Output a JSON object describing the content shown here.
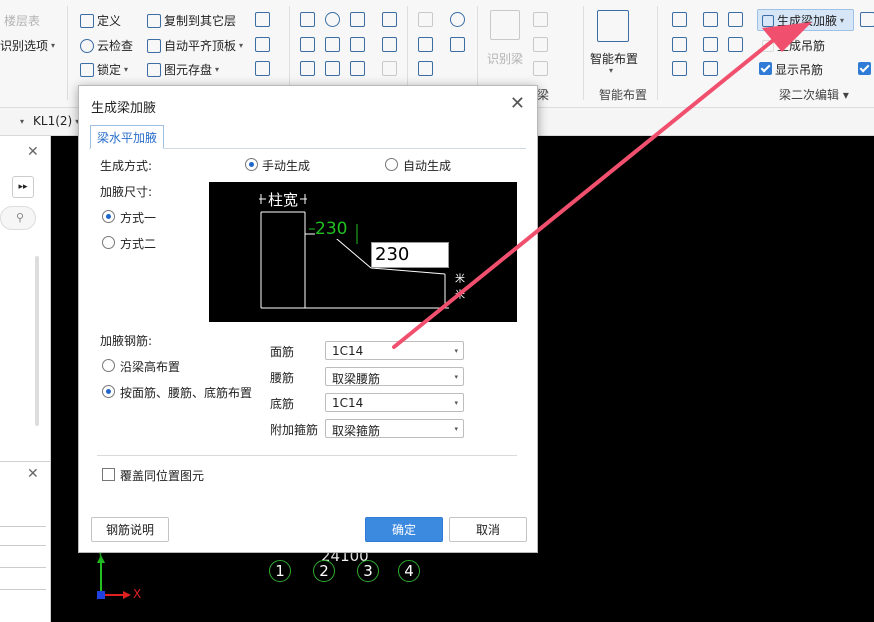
{
  "ribbon": {
    "col0": [
      "楼层表",
      "识别选项"
    ],
    "col1": [
      "定义",
      "云检查",
      "锁定"
    ],
    "col2": [
      "复制到其它层",
      "自动平齐顶板",
      "图元存盘"
    ],
    "identify_beam": "识别梁",
    "beam_partial": "梁",
    "smart_layout": "智能布置",
    "smart_layout_group": "智能布置",
    "generate_haunch": "生成梁加腋",
    "generate_hanger": "生成吊筋",
    "show_hanger": "显示吊筋",
    "beam_secondary_edit": "梁二次编辑"
  },
  "toolbar2": {
    "element": "KL1(2)"
  },
  "axes": [
    "1",
    "2",
    "3",
    "4"
  ],
  "dimension": "24100",
  "coordinate_axes": {
    "x": "X",
    "y": "Y"
  },
  "dialog": {
    "title": "生成梁加腋",
    "tab": "梁水平加腋",
    "generate_mode_label": "生成方式:",
    "mode_manual": "手动生成",
    "mode_auto": "自动生成",
    "haunch_size_label": "加腋尺寸:",
    "size_opt1": "方式一",
    "size_opt2": "方式二",
    "preview": {
      "col_width": "柱宽",
      "dim1": "230",
      "dim2": "230"
    },
    "rebar_label": "加腋钢筋:",
    "rebar_opt1": "沿梁高布置",
    "rebar_opt2": "按面筋、腰筋、底筋布置",
    "fields": [
      {
        "label": "面筋",
        "value": "1C14"
      },
      {
        "label": "腰筋",
        "value": "取梁腰筋"
      },
      {
        "label": "底筋",
        "value": "1C14"
      },
      {
        "label": "附加箍筋",
        "value": "取梁箍筋"
      }
    ],
    "overwrite_label": "覆盖同位置图元",
    "rebar_help_button": "钢筋说明",
    "ok_button": "确定",
    "cancel_button": "取消"
  },
  "colors": {
    "accent": "#3c8ae0",
    "arrow": "#f0506e",
    "canvas": "#000000",
    "axis_green": "#2fae2f"
  }
}
